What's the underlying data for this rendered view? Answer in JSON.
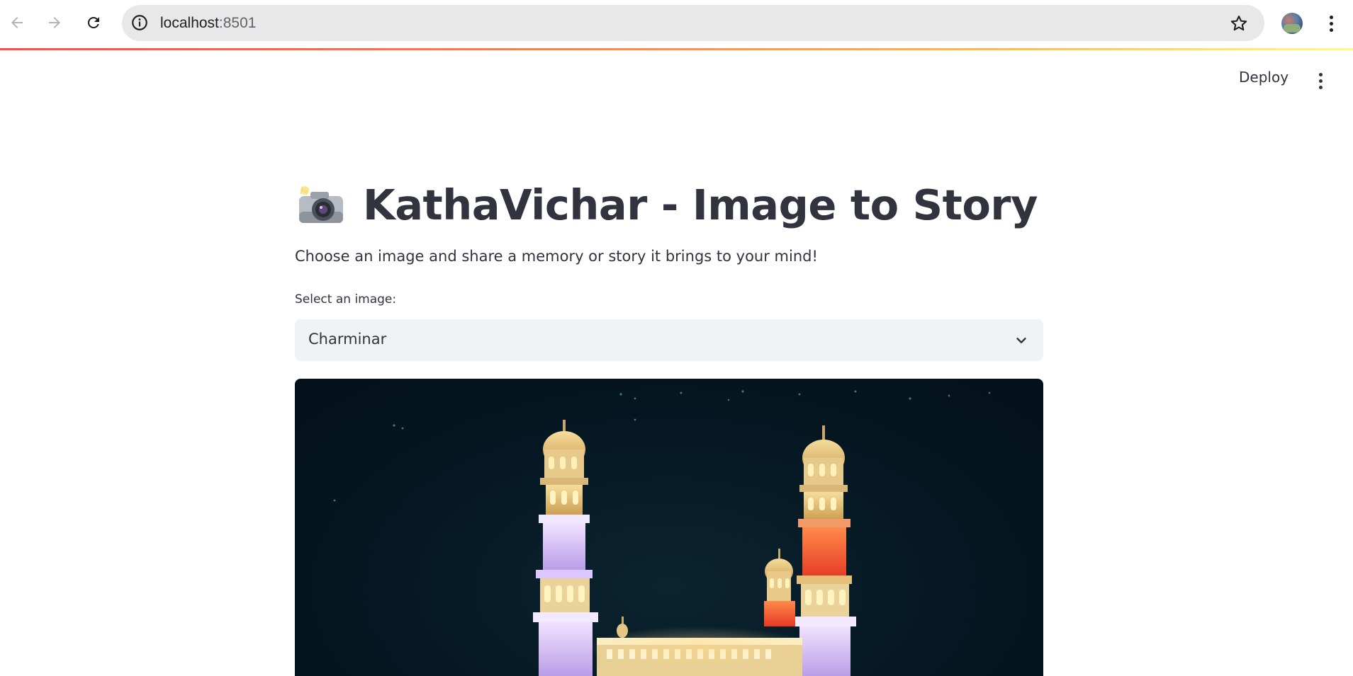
{
  "browser": {
    "url_host": "localhost",
    "url_port": ":8501"
  },
  "header": {
    "deploy_label": "Deploy"
  },
  "main": {
    "title": "KathaVichar - Image to Story",
    "title_icon": "camera-with-flash-icon",
    "subtitle": "Choose an image and share a memory or story it brings to your mind!",
    "select_label": "Select an image:",
    "select_value": "Charminar",
    "image_subject": "Charminar"
  },
  "colors": {
    "text": "#31333f",
    "select_bg": "#f0f2f6",
    "accent": "#ff4b4b",
    "omnibox_bg": "#e8e8e8"
  }
}
